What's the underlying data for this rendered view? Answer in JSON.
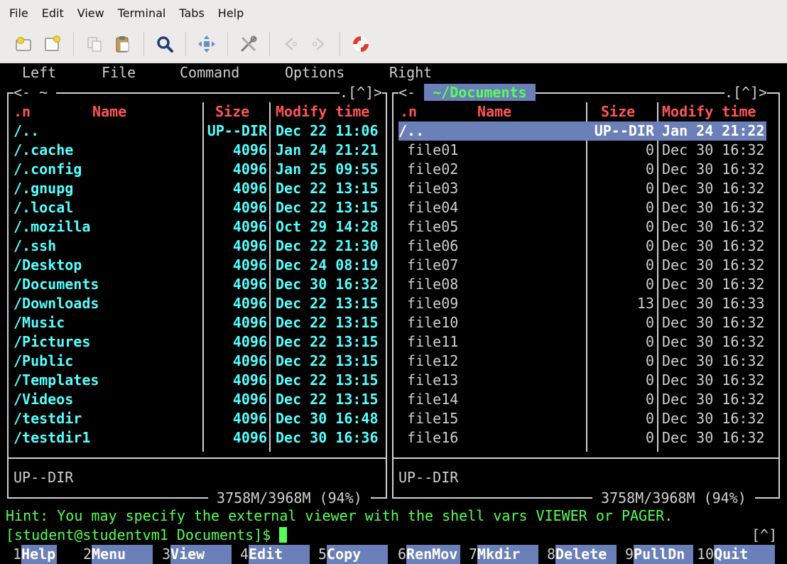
{
  "window": {
    "menu": [
      "File",
      "Edit",
      "View",
      "Terminal",
      "Tabs",
      "Help"
    ],
    "toolbar_icons": [
      "new-tab-icon",
      "new-window-icon",
      "copy-icon",
      "paste-icon",
      "search-icon",
      "fullscreen-icon",
      "preferences-icon",
      "back-icon",
      "forward-icon",
      "help-icon"
    ]
  },
  "mc": {
    "menu": {
      "left": "Left",
      "file": "File",
      "command": "Command",
      "options": "Options",
      "right": "Right"
    },
    "left_panel": {
      "path": "~",
      "corner": ".[^]",
      "headers": {
        "n": ".n",
        "name": "Name",
        "size": "Size",
        "mtime": "Modify time"
      },
      "rows": [
        {
          "name": "/..",
          "size": "UP--DIR",
          "mtime": "Dec 22 11:06"
        },
        {
          "name": "/.cache",
          "size": "4096",
          "mtime": "Jan 24 21:21"
        },
        {
          "name": "/.config",
          "size": "4096",
          "mtime": "Jan 25 09:55"
        },
        {
          "name": "/.gnupg",
          "size": "4096",
          "mtime": "Dec 22 13:15"
        },
        {
          "name": "/.local",
          "size": "4096",
          "mtime": "Dec 22 13:15"
        },
        {
          "name": "/.mozilla",
          "size": "4096",
          "mtime": "Oct 29 14:28"
        },
        {
          "name": "/.ssh",
          "size": "4096",
          "mtime": "Dec 22 21:30"
        },
        {
          "name": "/Desktop",
          "size": "4096",
          "mtime": "Dec 24 08:19"
        },
        {
          "name": "/Documents",
          "size": "4096",
          "mtime": "Dec 30 16:32"
        },
        {
          "name": "/Downloads",
          "size": "4096",
          "mtime": "Dec 22 13:15"
        },
        {
          "name": "/Music",
          "size": "4096",
          "mtime": "Dec 22 13:15"
        },
        {
          "name": "/Pictures",
          "size": "4096",
          "mtime": "Dec 22 13:15"
        },
        {
          "name": "/Public",
          "size": "4096",
          "mtime": "Dec 22 13:15"
        },
        {
          "name": "/Templates",
          "size": "4096",
          "mtime": "Dec 22 13:15"
        },
        {
          "name": "/Videos",
          "size": "4096",
          "mtime": "Dec 22 13:15"
        },
        {
          "name": "/testdir",
          "size": "4096",
          "mtime": "Dec 30 16:48"
        },
        {
          "name": "/testdir1",
          "size": "4096",
          "mtime": "Dec 30 16:36"
        }
      ],
      "status": "UP--DIR",
      "disk": "3758M/3968M (94%)"
    },
    "right_panel": {
      "path": "~/Documents",
      "corner": ".[^]",
      "headers": {
        "n": ".n",
        "name": "Name",
        "size": "Size",
        "mtime": "Modify time"
      },
      "rows": [
        {
          "name": "/..",
          "size": "UP--DIR",
          "mtime": "Jan 24 21:22"
        },
        {
          "name": " file01",
          "size": "0",
          "mtime": "Dec 30 16:32"
        },
        {
          "name": " file02",
          "size": "0",
          "mtime": "Dec 30 16:32"
        },
        {
          "name": " file03",
          "size": "0",
          "mtime": "Dec 30 16:32"
        },
        {
          "name": " file04",
          "size": "0",
          "mtime": "Dec 30 16:32"
        },
        {
          "name": " file05",
          "size": "0",
          "mtime": "Dec 30 16:32"
        },
        {
          "name": " file06",
          "size": "0",
          "mtime": "Dec 30 16:32"
        },
        {
          "name": " file07",
          "size": "0",
          "mtime": "Dec 30 16:32"
        },
        {
          "name": " file08",
          "size": "0",
          "mtime": "Dec 30 16:32"
        },
        {
          "name": " file09",
          "size": "13",
          "mtime": "Dec 30 16:33"
        },
        {
          "name": " file10",
          "size": "0",
          "mtime": "Dec 30 16:32"
        },
        {
          "name": " file11",
          "size": "0",
          "mtime": "Dec 30 16:32"
        },
        {
          "name": " file12",
          "size": "0",
          "mtime": "Dec 30 16:32"
        },
        {
          "name": " file13",
          "size": "0",
          "mtime": "Dec 30 16:32"
        },
        {
          "name": " file14",
          "size": "0",
          "mtime": "Dec 30 16:32"
        },
        {
          "name": " file15",
          "size": "0",
          "mtime": "Dec 30 16:32"
        },
        {
          "name": " file16",
          "size": "0",
          "mtime": "Dec 30 16:32"
        }
      ],
      "status": "UP--DIR",
      "disk": "3758M/3968M (94%)"
    },
    "hint": "Hint: You may specify the external viewer with the shell vars VIEWER or PAGER.",
    "prompt": "[student@studentvm1 Documents]$ ",
    "history_marker": "[^]",
    "fkeys": [
      {
        "n": "1",
        "label": "Help"
      },
      {
        "n": "2",
        "label": "Menu"
      },
      {
        "n": "3",
        "label": "View"
      },
      {
        "n": "4",
        "label": "Edit"
      },
      {
        "n": "5",
        "label": "Copy"
      },
      {
        "n": "6",
        "label": "RenMov"
      },
      {
        "n": "7",
        "label": "Mkdir"
      },
      {
        "n": "8",
        "label": "Delete"
      },
      {
        "n": "9",
        "label": "PullDn"
      },
      {
        "n": "10",
        "label": "Quit"
      }
    ]
  }
}
